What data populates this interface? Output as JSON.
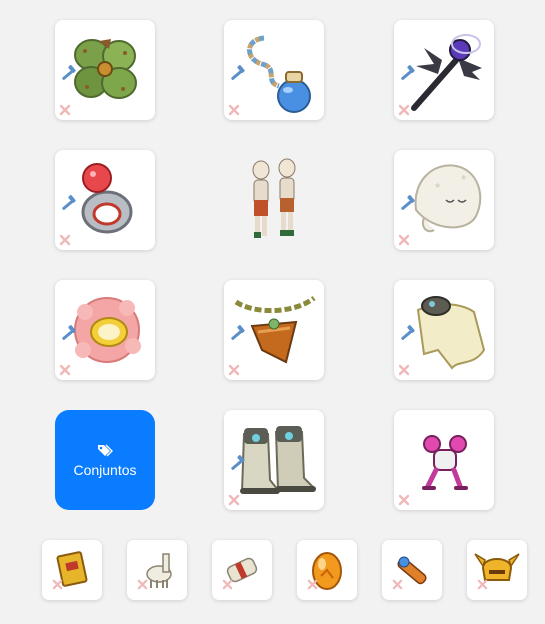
{
  "equipment": {
    "slots": [
      {
        "id": "amulet",
        "icon": "clover-amulet-icon"
      },
      {
        "id": "shield",
        "icon": "potion-whip-icon"
      },
      {
        "id": "weapon",
        "icon": "dark-staff-icon"
      },
      {
        "id": "ring-left",
        "icon": "red-gem-ring-icon"
      },
      {
        "id": "hat",
        "icon": "white-sleep-cap-icon"
      },
      {
        "id": "ring-right",
        "icon": "pink-flower-ring-icon"
      },
      {
        "id": "belt",
        "icon": "chain-belt-icon"
      },
      {
        "id": "cape",
        "icon": "cream-cape-icon"
      },
      {
        "id": "boots",
        "icon": "armored-boots-icon"
      },
      {
        "id": "pet",
        "icon": "pink-pet-icon"
      }
    ],
    "character": {
      "icon": "character-preview-icon"
    },
    "sets_button": {
      "label": "Conjuntos",
      "icon": "tags-icon"
    },
    "dofus_slots": [
      {
        "icon": "golden-book-icon"
      },
      {
        "icon": "white-llama-icon"
      },
      {
        "icon": "scroll-icon"
      },
      {
        "icon": "amber-egg-icon"
      },
      {
        "icon": "spyglass-icon"
      },
      {
        "icon": "horned-helmet-icon"
      }
    ]
  },
  "colors": {
    "accent": "#0a7cff",
    "background": "#f2f2f2",
    "remove": "#f0b8b8",
    "edit": "#5b8fc9"
  }
}
